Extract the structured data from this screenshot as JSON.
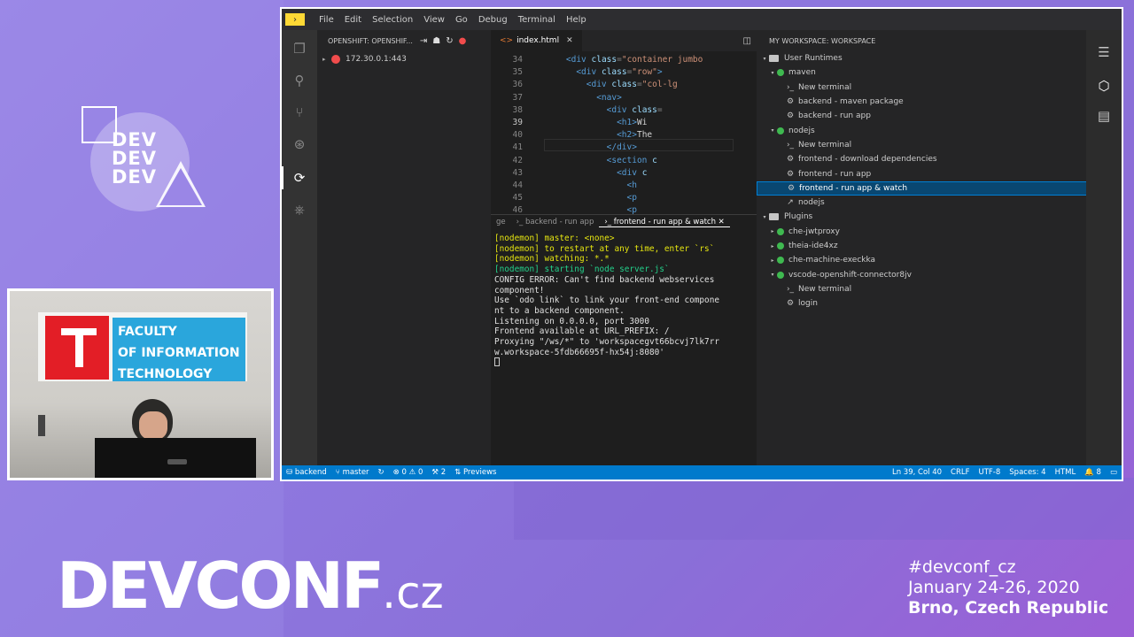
{
  "menubar": {
    "logo": "›",
    "items": [
      "File",
      "Edit",
      "Selection",
      "View",
      "Go",
      "Debug",
      "Terminal",
      "Help"
    ]
  },
  "openshift": {
    "header": "OPENSHIFT: OPENSHIF...",
    "cluster": "172.30.0.1:443"
  },
  "editor": {
    "tab_label": "index.html",
    "lines": [
      {
        "n": "34",
        "indent": "    ",
        "html": "<span class='tag'>&lt;div</span> <span class='attr'>class</span>=<span class='str'>\"container jumbo</span>"
      },
      {
        "n": "35",
        "indent": "      ",
        "html": "<span class='tag'>&lt;div</span> <span class='attr'>class</span>=<span class='str'>\"row\"</span><span class='tag'>&gt;</span>"
      },
      {
        "n": "36",
        "indent": "        ",
        "html": "<span class='tag'>&lt;div</span> <span class='attr'>class</span>=<span class='str'>\"col-lg</span>"
      },
      {
        "n": "37",
        "indent": "          ",
        "html": "<span class='tag'>&lt;nav&gt;</span>"
      },
      {
        "n": "38",
        "indent": "            ",
        "html": "<span class='tag'>&lt;div</span> <span class='attr'>class</span>="
      },
      {
        "n": "39",
        "indent": "              ",
        "html": "<span class='tag'>&lt;h1&gt;</span><span class='txt'>Wi</span>"
      },
      {
        "n": "40",
        "indent": "              ",
        "html": "<span class='tag'>&lt;h2&gt;</span><span class='txt'>The</span>"
      },
      {
        "n": "41",
        "indent": "            ",
        "html": "<span class='tag'>&lt;/div&gt;</span>"
      },
      {
        "n": "42",
        "indent": "            ",
        "html": "<span class='tag'>&lt;section</span> <span class='attr'>c</span>"
      },
      {
        "n": "43",
        "indent": "              ",
        "html": "<span class='tag'>&lt;div</span> <span class='attr'>c</span>"
      },
      {
        "n": "44",
        "indent": "                ",
        "html": "<span class='tag'>&lt;h</span>"
      },
      {
        "n": "45",
        "indent": "                ",
        "html": "<span class='tag'>&lt;p</span>"
      },
      {
        "n": "46",
        "indent": "                ",
        "html": "<span class='tag'>&lt;p</span>"
      }
    ],
    "current_line": "39"
  },
  "terminal": {
    "tabs": [
      "ge",
      "backend - run app",
      "frontend - run app & watch"
    ],
    "lines": [
      {
        "t": "[nodemon] master: <none>",
        "c": "y"
      },
      {
        "t": "[nodemon] to restart at any time, enter `rs`",
        "c": "y"
      },
      {
        "t": "[nodemon] watching: *.*",
        "c": "y"
      },
      {
        "t": "[nodemon] starting `node server.js`",
        "c": "g"
      },
      {
        "t": "CONFIG ERROR: Can't find backend webservices",
        "c": ""
      },
      {
        "t": "component!",
        "c": ""
      },
      {
        "t": "Use `odo link` to link your front-end compone",
        "c": ""
      },
      {
        "t": "nt to a backend component.",
        "c": ""
      },
      {
        "t": "Listening on 0.0.0.0, port 3000",
        "c": ""
      },
      {
        "t": "Frontend available at URL_PREFIX: /",
        "c": ""
      },
      {
        "t": "Proxying \"/ws/*\" to 'workspacegvt66bcvj7lk7rr",
        "c": ""
      },
      {
        "t": "w.workspace-5fdb66695f-hx54j:8080'",
        "c": ""
      }
    ]
  },
  "workspace": {
    "header": "MY WORKSPACE: WORKSPACE",
    "tree": [
      {
        "label": "User Runtimes",
        "type": "folder",
        "level": 0,
        "twisty": "▾"
      },
      {
        "label": "maven",
        "type": "runtime",
        "level": 1,
        "twisty": "▾"
      },
      {
        "label": "New terminal",
        "type": "terminal",
        "level": 2
      },
      {
        "label": "backend - maven package",
        "type": "task",
        "level": 2
      },
      {
        "label": "backend - run app",
        "type": "task",
        "level": 2
      },
      {
        "label": "nodejs",
        "type": "runtime",
        "level": 1,
        "twisty": "▾"
      },
      {
        "label": "New terminal",
        "type": "terminal",
        "level": 2
      },
      {
        "label": "frontend - download dependencies",
        "type": "task",
        "level": 2
      },
      {
        "label": "frontend - run app",
        "type": "task",
        "level": 2
      },
      {
        "label": "frontend - run app & watch",
        "type": "task",
        "level": 2,
        "selected": true
      },
      {
        "label": "nodejs",
        "type": "link",
        "level": 2
      },
      {
        "label": "Plugins",
        "type": "folder",
        "level": 0,
        "twisty": "▾"
      },
      {
        "label": "che-jwtproxy",
        "type": "runtime",
        "level": 1,
        "twisty": "▸"
      },
      {
        "label": "theia-ide4xz",
        "type": "runtime",
        "level": 1,
        "twisty": "▸"
      },
      {
        "label": "che-machine-execkka",
        "type": "runtime",
        "level": 1,
        "twisty": "▸"
      },
      {
        "label": "vscode-openshift-connector8jv",
        "type": "runtime",
        "level": 1,
        "twisty": "▾"
      },
      {
        "label": "New terminal",
        "type": "terminal",
        "level": 2
      },
      {
        "label": "login",
        "type": "task",
        "level": 2
      }
    ]
  },
  "statusbar": {
    "workspace": "backend",
    "branch": "master",
    "errors": "0",
    "warnings": "0",
    "ports": "2",
    "previews": "Previews",
    "position": "Ln 39, Col 40",
    "eol": "CRLF",
    "encoding": "UTF-8",
    "spaces": "Spaces: 4",
    "language": "HTML",
    "notifications": "8"
  },
  "webcam": {
    "sign_line1": "FACULTY",
    "sign_line2": "OF INFORMATION",
    "sign_line3": "TECHNOLOGY"
  },
  "branding": {
    "logo_text": "DEV\nDEV\nDEV",
    "devconf_main": "DEVCONF",
    "devconf_tld": ".cz",
    "hashtag": "#devconf_cz",
    "dates": "January 24-26, 2020",
    "location": "Brno, Czech Republic"
  },
  "colors": {
    "accent": "#007acc",
    "selection": "#094771",
    "runtime_dot": "#3fb950",
    "error": "#f14c4c"
  }
}
